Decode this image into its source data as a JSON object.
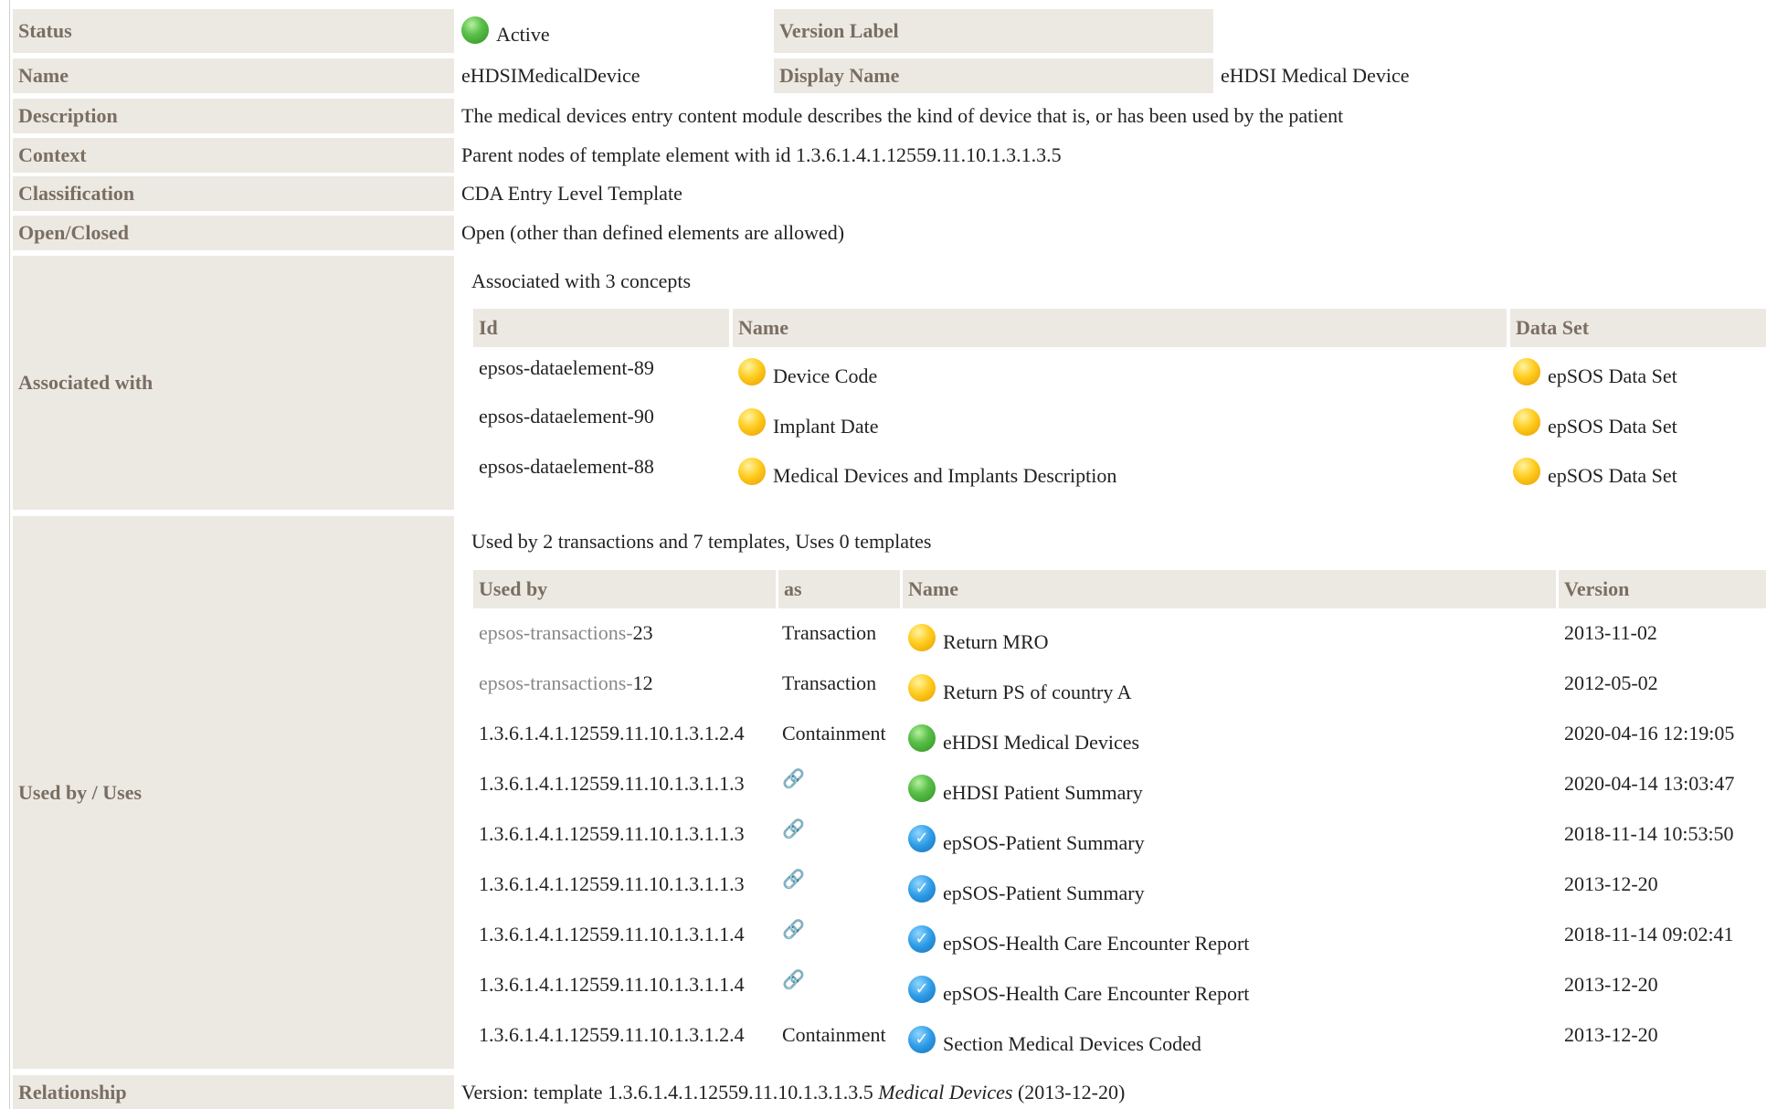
{
  "status": {
    "label": "Status",
    "value": "Active"
  },
  "version_label": {
    "label": "Version Label",
    "value": ""
  },
  "name": {
    "label": "Name",
    "value": "eHDSIMedicalDevice"
  },
  "display_name": {
    "label": "Display Name",
    "value": "eHDSI Medical Device"
  },
  "description": {
    "label": "Description",
    "value": "The medical devices entry content module describes the kind of device that is, or has been used by the patient"
  },
  "context": {
    "label": "Context",
    "value": "Parent nodes of template element with id 1.3.6.1.4.1.12559.11.10.1.3.1.3.5"
  },
  "classification": {
    "label": "Classification",
    "value": "CDA Entry Level Template"
  },
  "open_closed": {
    "label": "Open/Closed",
    "value": "Open (other than defined elements are allowed)"
  },
  "associated": {
    "label": "Associated with",
    "summary": "Associated with 3 concepts",
    "headers": {
      "id": "Id",
      "name": "Name",
      "dataset": "Data Set"
    },
    "rows": [
      {
        "id": "epsos-dataelement-89",
        "name": "Device Code",
        "dataset": "epSOS Data Set"
      },
      {
        "id": "epsos-dataelement-90",
        "name": "Implant Date",
        "dataset": "epSOS Data Set"
      },
      {
        "id": "epsos-dataelement-88",
        "name": "Medical Devices and Implants Description",
        "dataset": "epSOS Data Set"
      }
    ]
  },
  "usedby": {
    "label": "Used by / Uses",
    "summary": "Used by 2 transactions and 7 templates, Uses 0 templates",
    "headers": {
      "usedby": "Used by",
      "as": "as",
      "name": "Name",
      "version": "Version"
    },
    "rows": [
      {
        "prefix": "epsos-transactions-",
        "id": "23",
        "as": "Transaction",
        "status": "yellow",
        "name": "Return MRO",
        "version": "2013-11-02"
      },
      {
        "prefix": "epsos-transactions-",
        "id": "12",
        "as": "Transaction",
        "status": "yellow",
        "name": "Return PS of country A",
        "version": "2012-05-02"
      },
      {
        "prefix": "",
        "id": "1.3.6.1.4.1.12559.11.10.1.3.1.2.4",
        "as": "Containment",
        "status": "green",
        "name": "eHDSI Medical Devices",
        "version": "2020-04-16 12:19:05"
      },
      {
        "prefix": "",
        "id": "1.3.6.1.4.1.12559.11.10.1.3.1.1.3",
        "as": "link-icon",
        "status": "green",
        "name": "eHDSI Patient Summary",
        "version": "2020-04-14 13:03:47"
      },
      {
        "prefix": "",
        "id": "1.3.6.1.4.1.12559.11.10.1.3.1.1.3",
        "as": "link-icon",
        "status": "blue",
        "name": "epSOS-Patient Summary",
        "version": "2018-11-14 10:53:50"
      },
      {
        "prefix": "",
        "id": "1.3.6.1.4.1.12559.11.10.1.3.1.1.3",
        "as": "link-icon",
        "status": "blue",
        "name": "epSOS-Patient Summary",
        "version": "2013-12-20"
      },
      {
        "prefix": "",
        "id": "1.3.6.1.4.1.12559.11.10.1.3.1.1.4",
        "as": "link-icon",
        "status": "blue",
        "name": "epSOS-Health Care Encounter Report",
        "version": "2018-11-14 09:02:41"
      },
      {
        "prefix": "",
        "id": "1.3.6.1.4.1.12559.11.10.1.3.1.1.4",
        "as": "link-icon",
        "status": "blue",
        "name": "epSOS-Health Care Encounter Report",
        "version": "2013-12-20"
      },
      {
        "prefix": "",
        "id": "1.3.6.1.4.1.12559.11.10.1.3.1.2.4",
        "as": "Containment",
        "status": "blue",
        "name": "Section Medical Devices Coded",
        "version": "2013-12-20"
      }
    ]
  },
  "relationship": {
    "label": "Relationship",
    "prefix": "Version: template 1.3.6.1.4.1.12559.11.10.1.3.1.3.5 ",
    "name": "Medical Devices",
    "suffix": " (2013-12-20)"
  }
}
